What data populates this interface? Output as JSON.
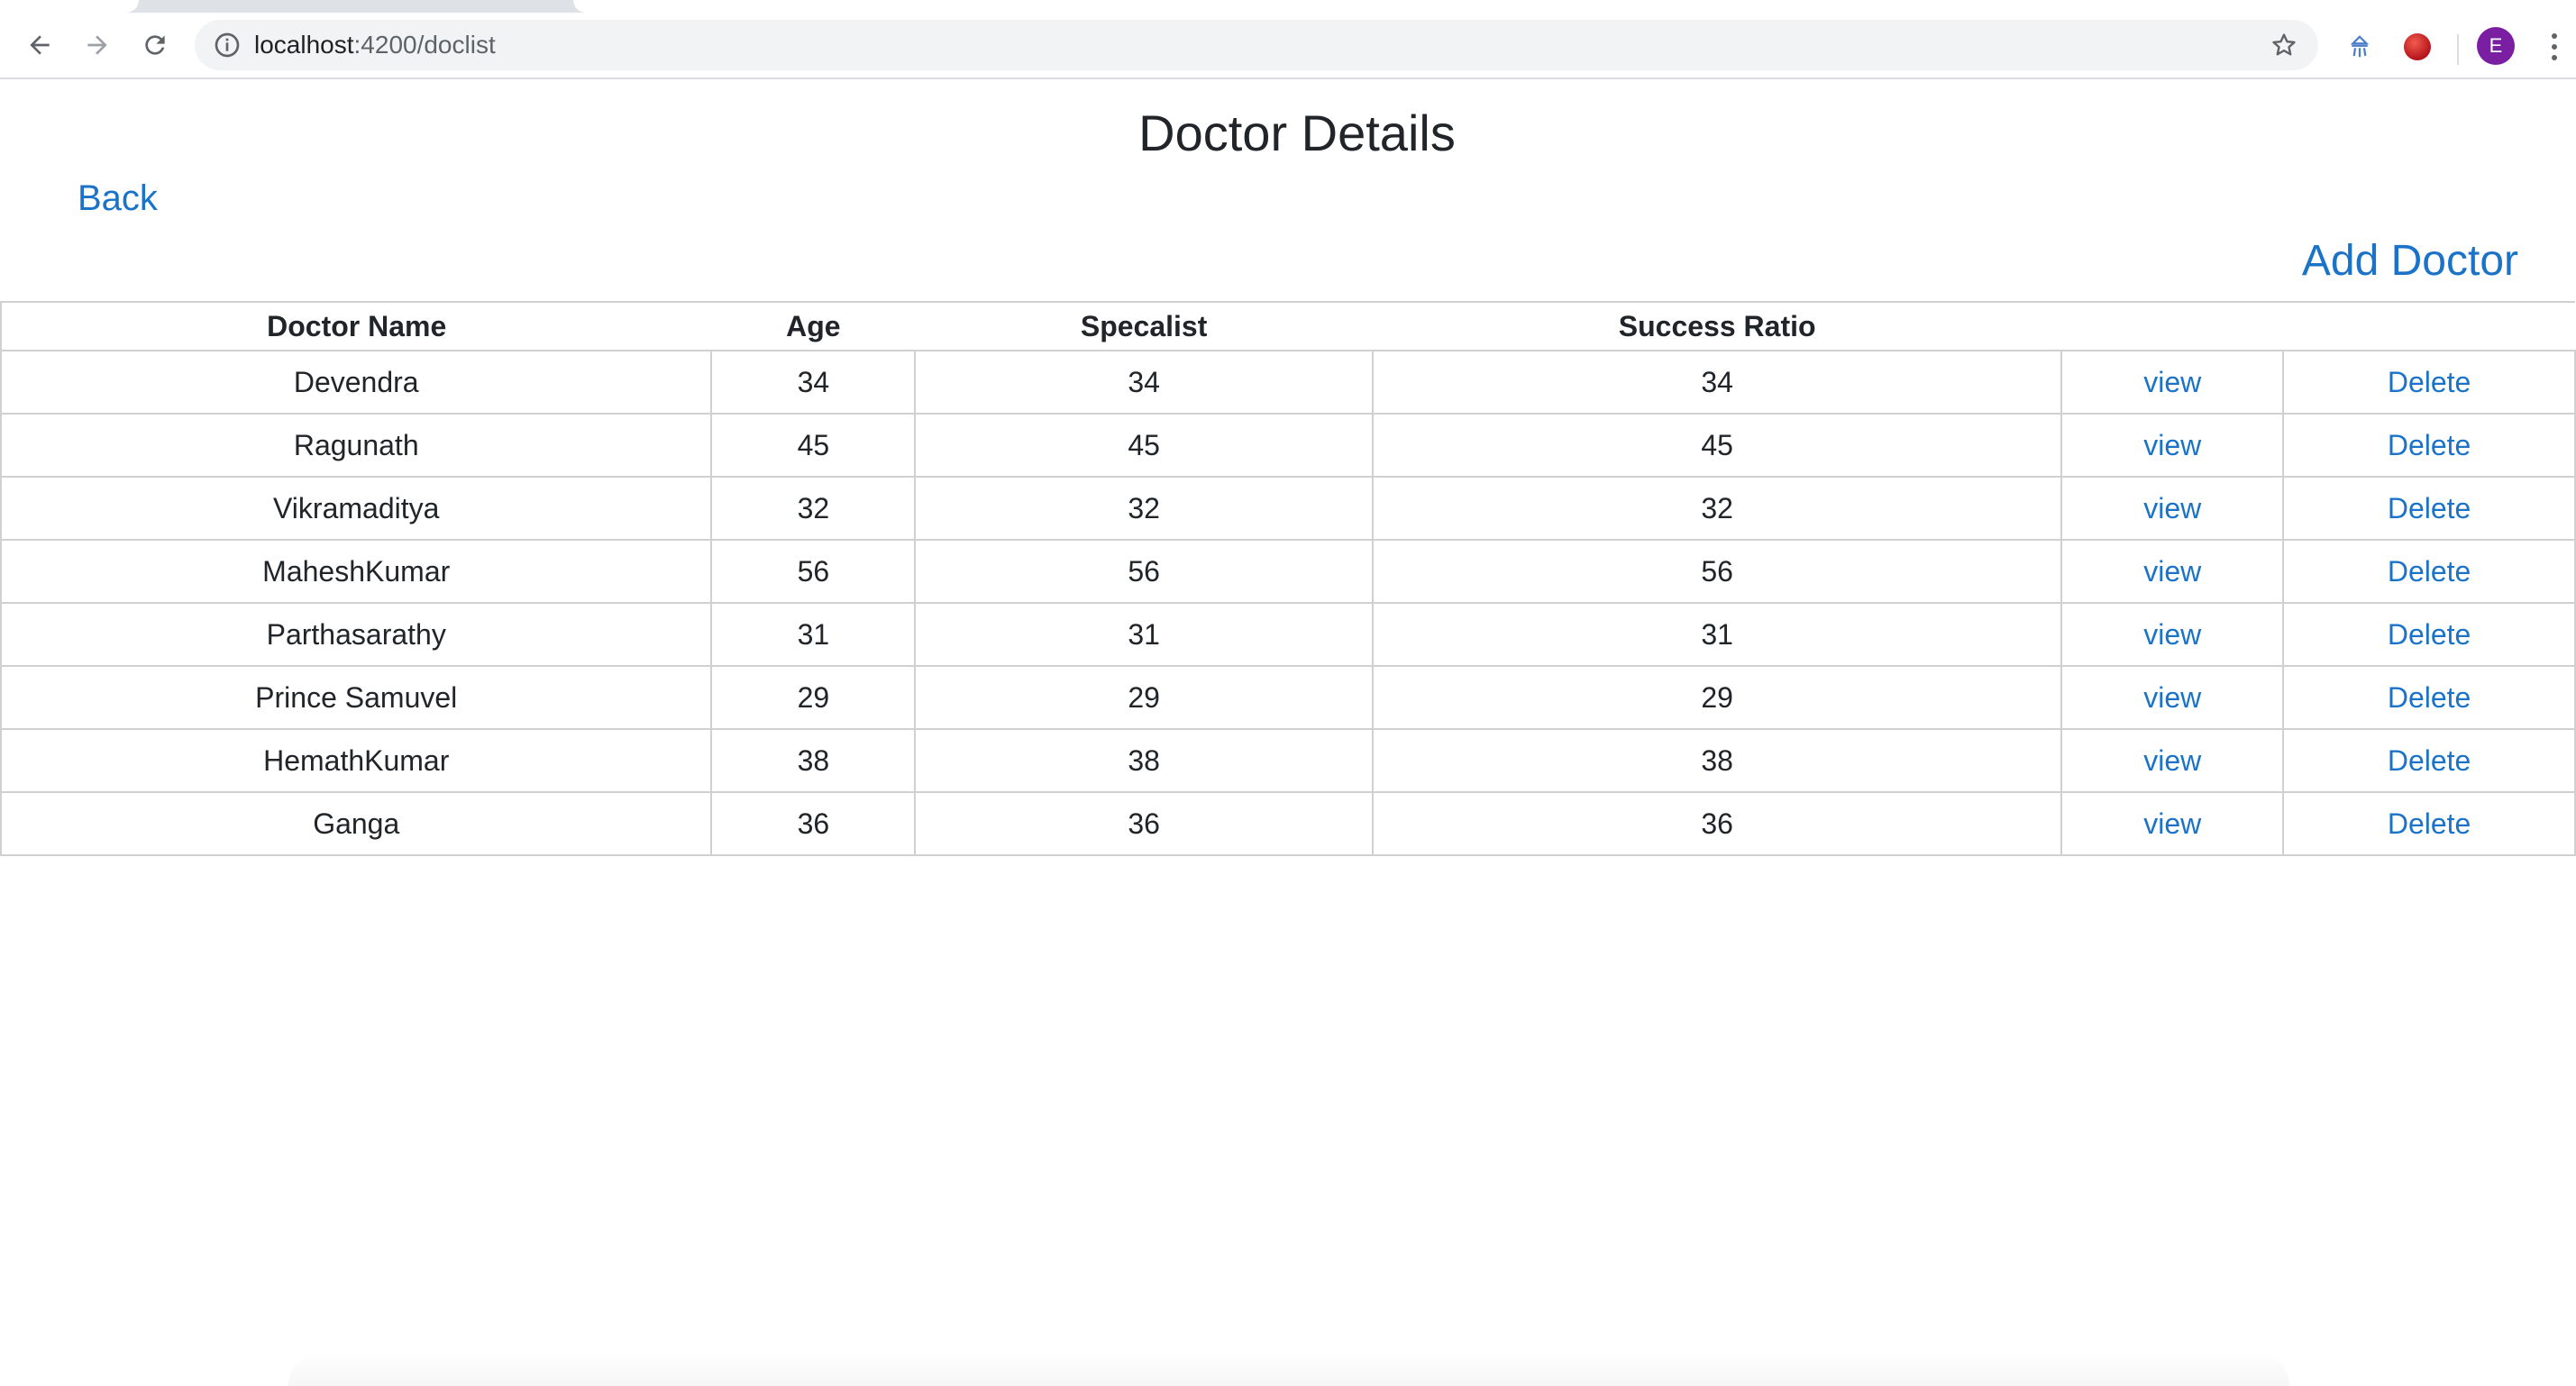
{
  "browser": {
    "url_host": "localhost",
    "url_path": ":4200/doclist",
    "profile_initial": "E"
  },
  "page": {
    "title": "Doctor Details",
    "back_label": "Back",
    "add_label": "Add Doctor"
  },
  "table": {
    "columns": [
      "Doctor Name",
      "Age",
      "Specalist",
      "Success Ratio",
      "",
      ""
    ],
    "rows": [
      {
        "name": "Devendra",
        "age": "34",
        "specialist": "34",
        "success": "34",
        "view": "view",
        "delete": "Delete"
      },
      {
        "name": "Ragunath",
        "age": "45",
        "specialist": "45",
        "success": "45",
        "view": "view",
        "delete": "Delete"
      },
      {
        "name": "Vikramaditya",
        "age": "32",
        "specialist": "32",
        "success": "32",
        "view": "view",
        "delete": "Delete"
      },
      {
        "name": "MaheshKumar",
        "age": "56",
        "specialist": "56",
        "success": "56",
        "view": "view",
        "delete": "Delete"
      },
      {
        "name": "Parthasarathy",
        "age": "31",
        "specialist": "31",
        "success": "31",
        "view": "view",
        "delete": "Delete"
      },
      {
        "name": "Prince Samuvel",
        "age": "29",
        "specialist": "29",
        "success": "29",
        "view": "view",
        "delete": "Delete"
      },
      {
        "name": "HemathKumar",
        "age": "38",
        "specialist": "38",
        "success": "38",
        "view": "view",
        "delete": "Delete"
      },
      {
        "name": "Ganga",
        "age": "36",
        "specialist": "36",
        "success": "36",
        "view": "view",
        "delete": "Delete"
      }
    ]
  },
  "colors": {
    "link": "#1a73c8",
    "text": "#212529",
    "border": "#d0d0d0",
    "avatar": "#7b1fa2"
  },
  "icons": [
    "back-arrow-icon",
    "forward-arrow-icon",
    "reload-icon",
    "info-icon",
    "star-icon",
    "extension-icon",
    "record-icon",
    "kebab-menu-icon"
  ]
}
